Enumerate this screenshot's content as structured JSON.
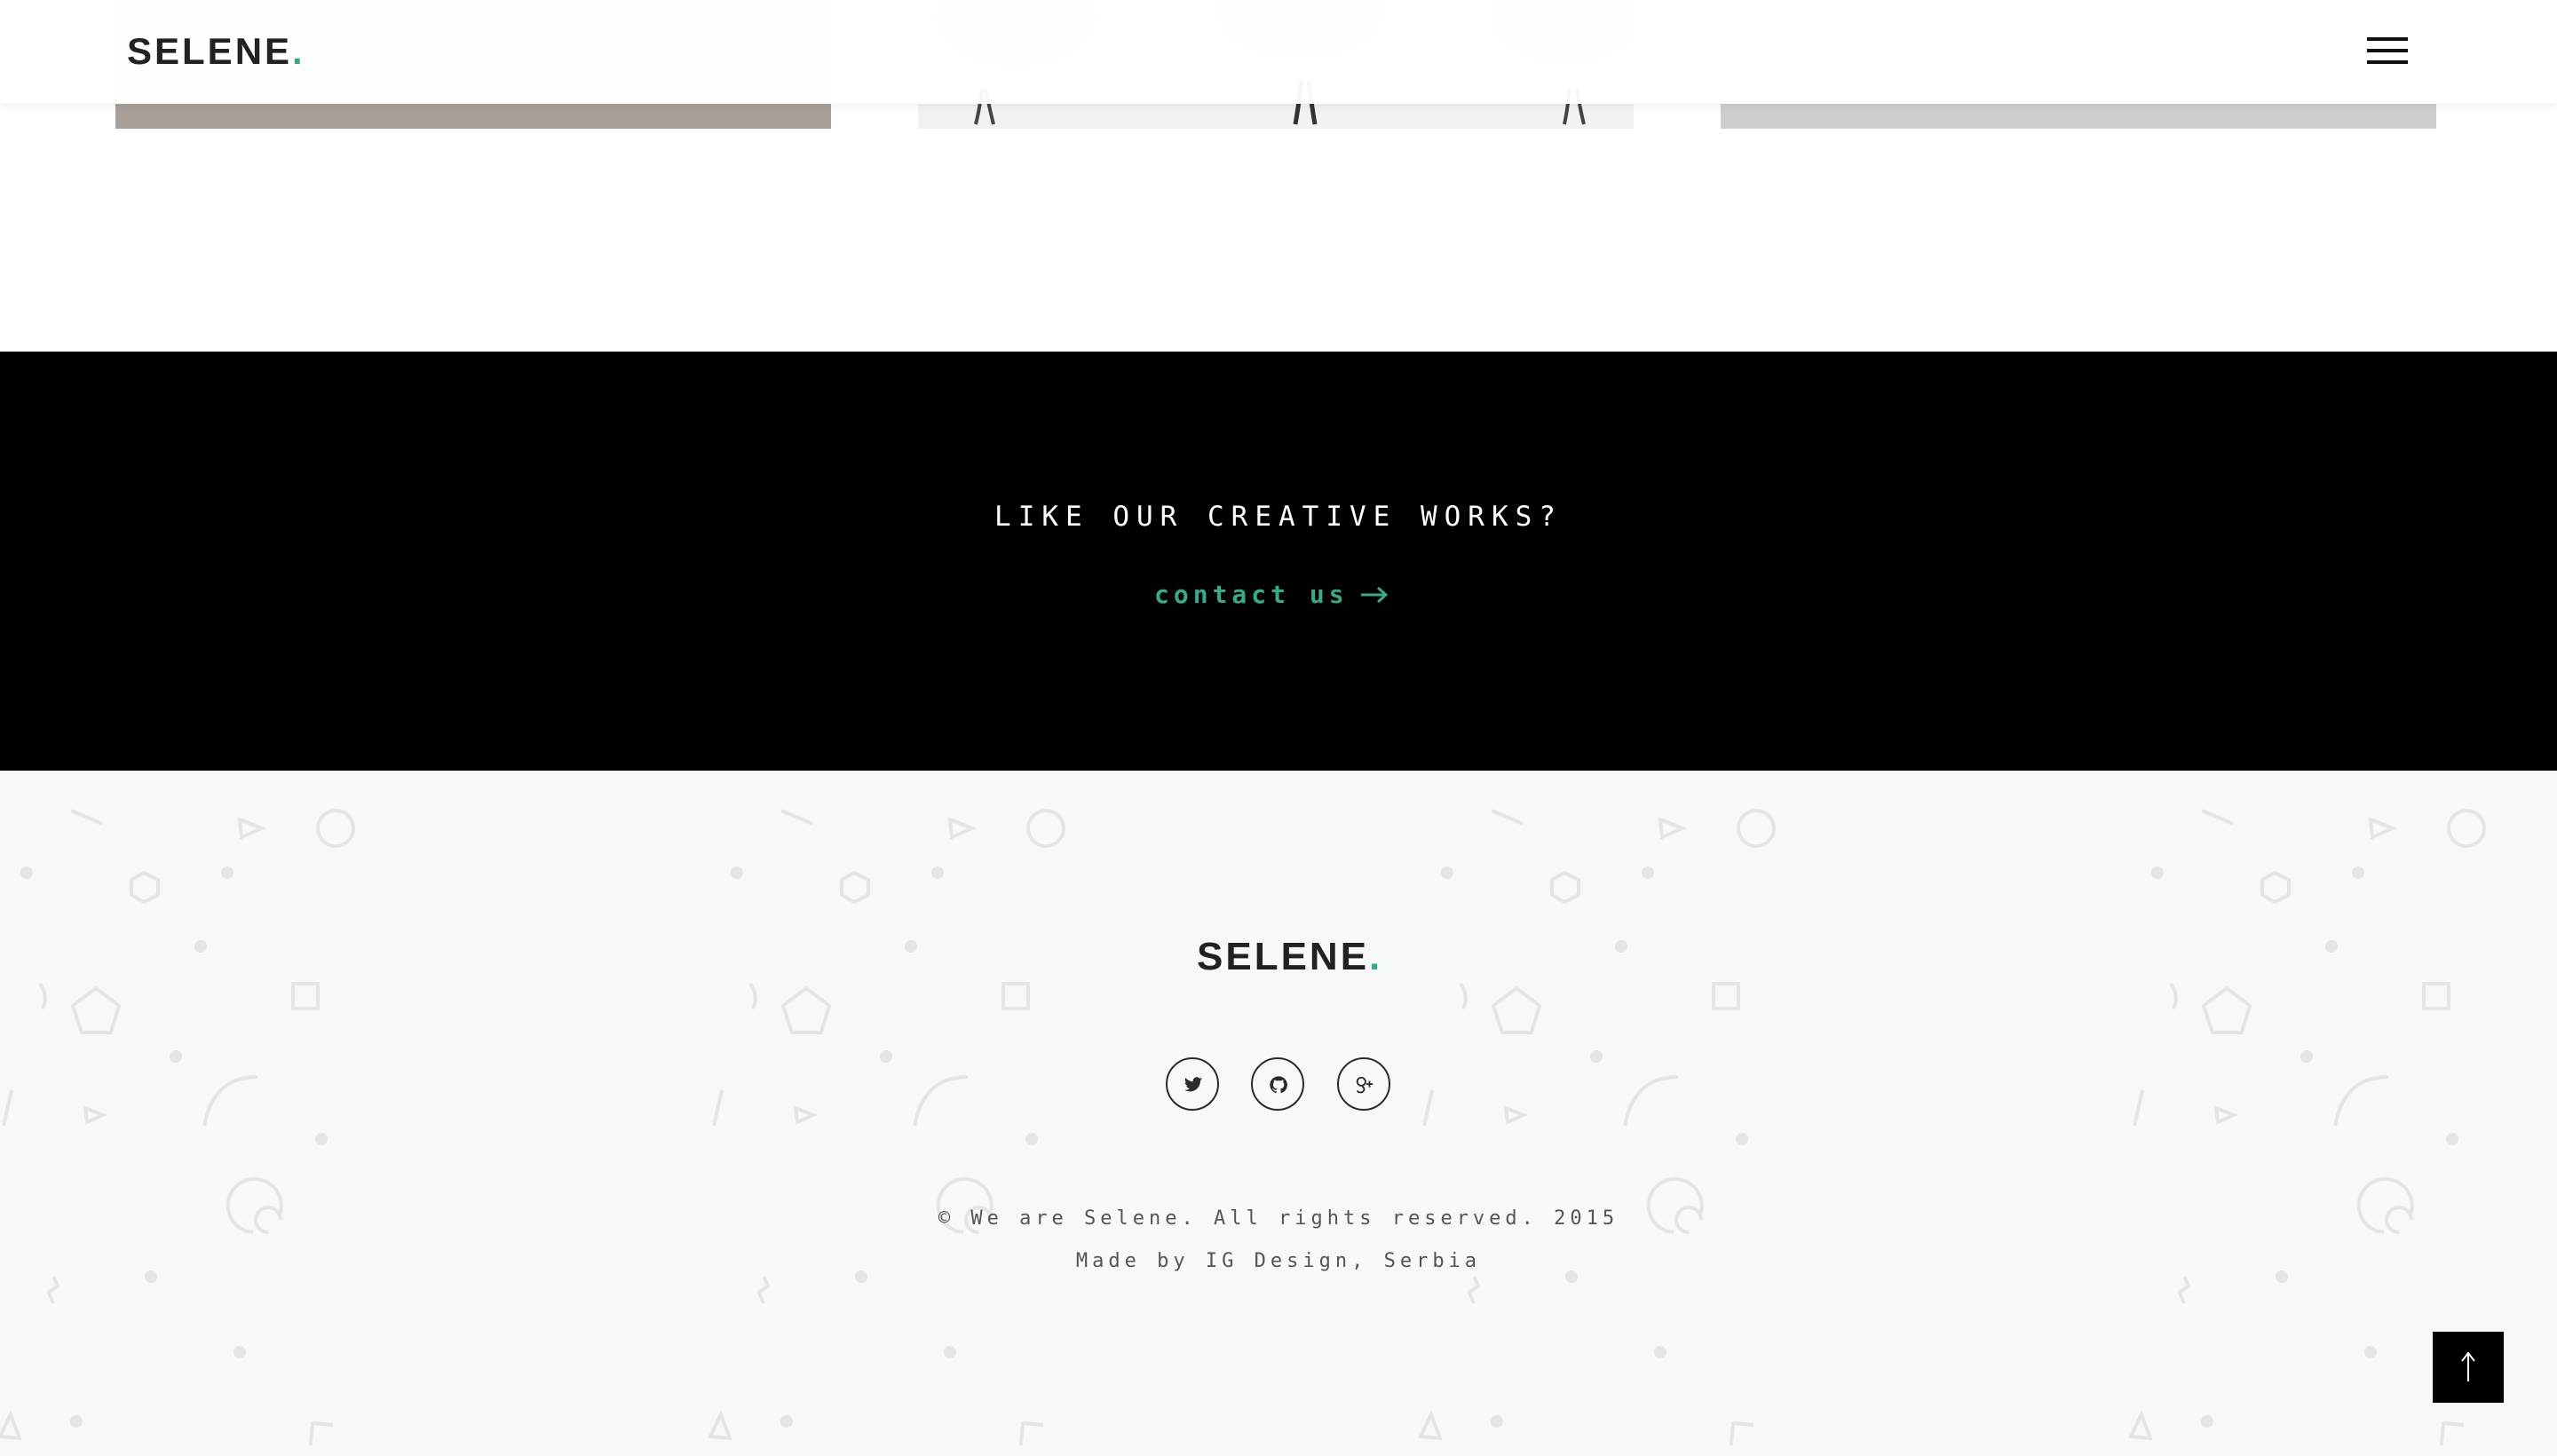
{
  "header": {
    "logo_text": "SELENE",
    "logo_dot": "."
  },
  "cta": {
    "title": "LIKE OUR CREATIVE WORKS?",
    "link_label": "contact us"
  },
  "footer": {
    "logo_text": "SELENE",
    "logo_dot": ".",
    "social": [
      {
        "icon": "twitter-icon"
      },
      {
        "icon": "github-icon"
      },
      {
        "icon": "google-plus-icon"
      }
    ],
    "copyright": "© We are Selene. All rights reserved. 2015",
    "credits": "Made by IG Design, Serbia"
  },
  "colors": {
    "accent": "#3aa98a",
    "dark": "#000000",
    "text": "#222222",
    "footer_bg": "#f7f8fa"
  },
  "icons": {
    "back_to_top": "arrow-up-icon",
    "menu": "hamburger-menu-icon",
    "cta_arrow": "arrow-right-icon"
  }
}
